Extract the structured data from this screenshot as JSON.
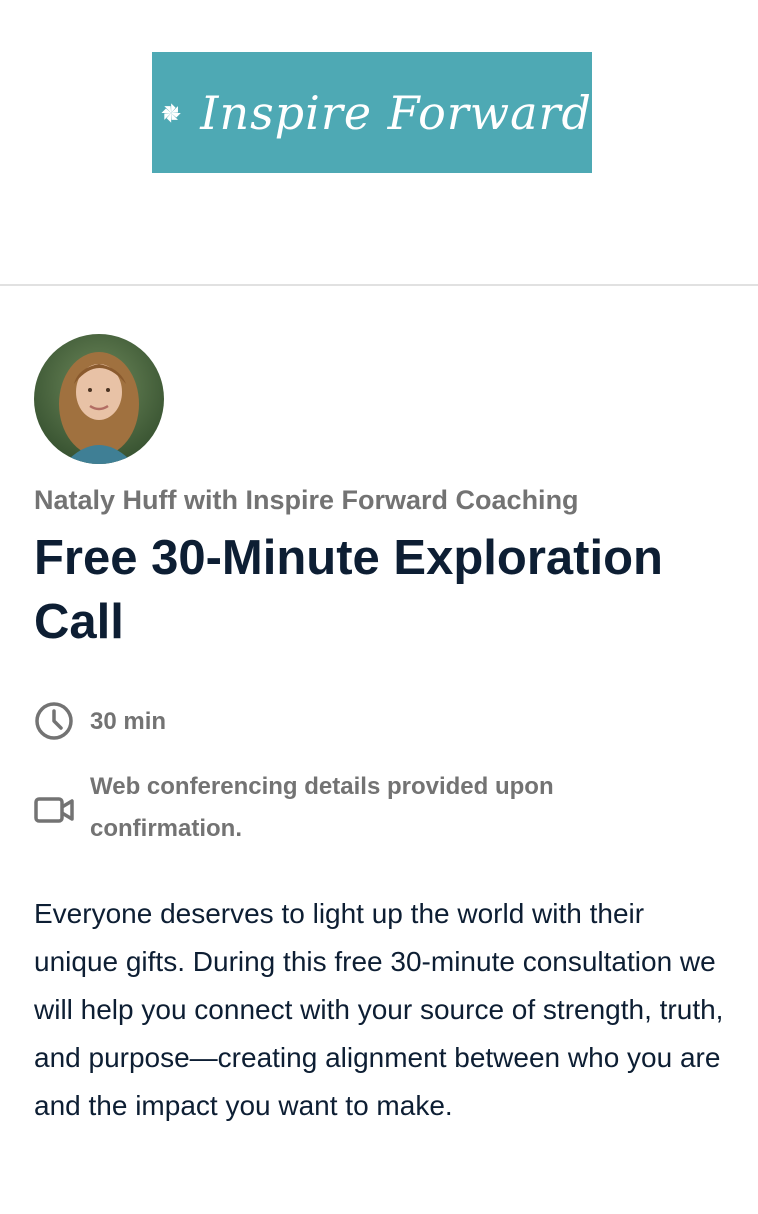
{
  "brand": {
    "logo_text": "Inspire Forward",
    "logo_background": "#4ea9b4",
    "logo_icon": "pinwheel-icon"
  },
  "event": {
    "organizer": "Nataly Huff with Inspire Forward Coaching",
    "title": "Free 30-Minute Exploration Call",
    "duration": "30 min",
    "duration_icon": "clock-icon",
    "location": "Web conferencing details provided upon confirmation.",
    "location_icon": "video-camera-icon",
    "description": "Everyone deserves to light up the world with their unique gifts. During this free 30-minute consultation we will help you connect with your source of strength, truth, and purpose—creating alignment between who you are and the impact you want to make."
  },
  "colors": {
    "title": "#0d1e33",
    "muted": "#737373",
    "divider": "#e1e1e1"
  }
}
